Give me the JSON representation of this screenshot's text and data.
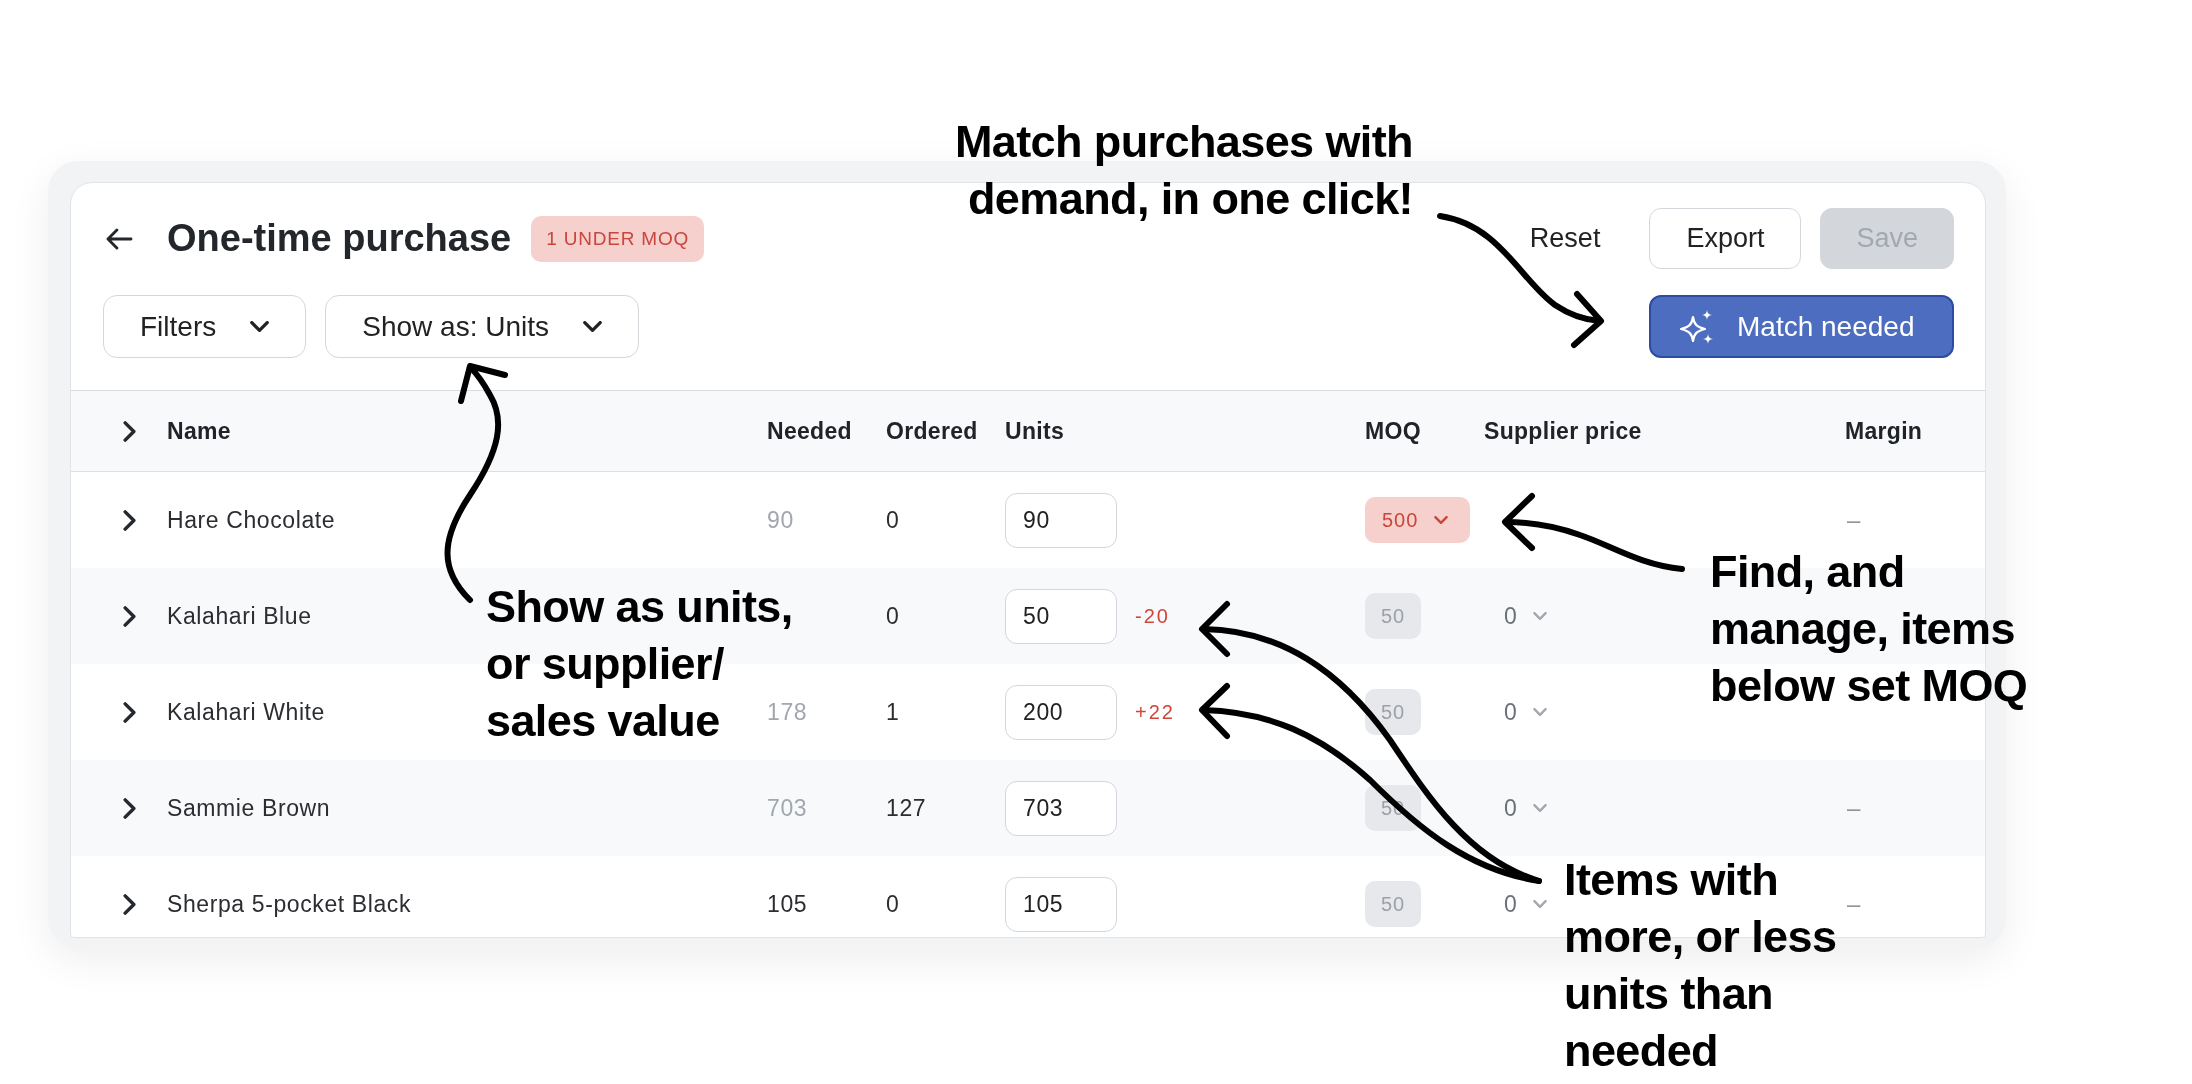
{
  "header": {
    "title": "One-time purchase",
    "badge": "1 UNDER MOQ"
  },
  "toolbar": [
    {
      "label": "Filters"
    },
    {
      "label": "Show as: Units"
    }
  ],
  "actions": [
    {
      "label": "Reset",
      "kind": "link",
      "disabled": false
    },
    {
      "label": "Export",
      "kind": "outline",
      "disabled": false
    },
    {
      "label": "Save",
      "kind": "primary",
      "disabled": true
    }
  ],
  "match_button": {
    "label": "Match needed"
  },
  "table": {
    "columns": [
      "Name",
      "Needed",
      "Ordered",
      "Units",
      "MOQ",
      "Supplier price",
      "Margin"
    ],
    "rows": [
      {
        "name": "Hare Chocolate",
        "expanded": false,
        "needed": {
          "text": "90",
          "muted": true
        },
        "ordered": "0",
        "units": "90",
        "moq": {
          "text": "500",
          "under": true
        },
        "margin": "–"
      },
      {
        "name": "Kalahari Blue",
        "expanded": false,
        "ordered": "0",
        "units": "50",
        "difference": "-20",
        "moq": {
          "text": "50",
          "under": false
        },
        "supplier_price": "0"
      },
      {
        "name": "Kalahari White",
        "expanded": false,
        "needed": {
          "text": "178",
          "muted": true
        },
        "ordered": "1",
        "units": "200",
        "difference": "+22",
        "moq": {
          "text": "50",
          "under": false
        },
        "supplier_price": "0"
      },
      {
        "name": "Sammie Brown",
        "expanded": false,
        "needed": {
          "text": "703",
          "muted": true
        },
        "ordered": "127",
        "units": "703",
        "moq": {
          "text": "50",
          "under": false
        },
        "supplier_price": "0",
        "margin": "–"
      },
      {
        "name": "Sherpa 5-pocket Black",
        "expanded": false,
        "needed": {
          "text": "105",
          "muted": false
        },
        "ordered": "0",
        "units": "105",
        "moq": {
          "text": "50",
          "under": false
        },
        "supplier_price": "0",
        "margin": "–"
      }
    ]
  },
  "annotations": [
    {
      "text": "Match purchases with\ndemand, in one click!"
    },
    {
      "text": "Show as units,\nor supplier/\nsales value"
    },
    {
      "text": "Find, and\nmanage, items\nbelow set MOQ"
    },
    {
      "text": "Items with\nmore, or less\nunits than\nneeded"
    }
  ]
}
